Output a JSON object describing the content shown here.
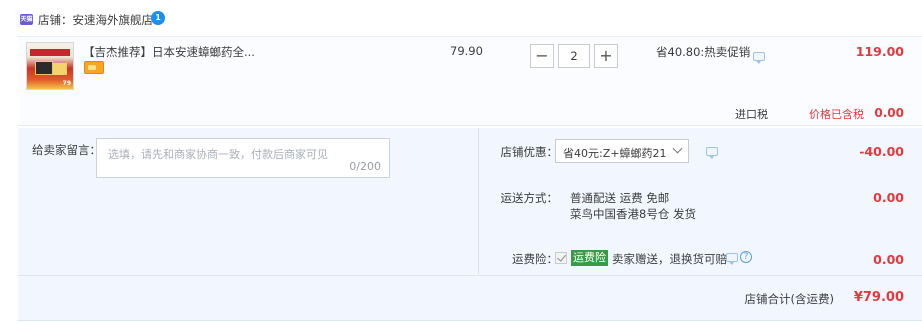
{
  "shop": {
    "icon_text": "天猫",
    "label": "店铺：安速海外旗舰店",
    "badge": "1"
  },
  "item": {
    "title": "【吉杰推荐】日本安速蟑螂药全...",
    "thumb_price": "79",
    "unit_price": "79.90",
    "qty_minus": "−",
    "qty_value": "2",
    "qty_plus": "+",
    "promo": "省40.80:热卖促销",
    "total": "119.00",
    "tax_label": "进口税",
    "tax_status": "价格已含税",
    "tax_value": "0.00"
  },
  "message": {
    "label": "给卖家留言：",
    "placeholder": "选填，请先和商家协商一致，付款后商家可见",
    "counter": "0/200"
  },
  "coupon": {
    "label": "店铺优惠：",
    "selected": "省40元:Z+蟑螂药21",
    "value": "-40.00"
  },
  "shipping": {
    "label": "运送方式：",
    "line1": "普通配送 运费 免邮",
    "warehouse": "菜鸟中国香港8号仓",
    "dispatch": "发货",
    "value": "0.00"
  },
  "insurance": {
    "label": "运费险：",
    "tag": "运费险",
    "desc": "卖家赠送，退换货可赔",
    "help": "?",
    "value": "0.00"
  },
  "summary": {
    "label": "店铺合计(含运费)",
    "total": "¥79.00"
  },
  "colors": {
    "accent_red": "#e4393c",
    "panel_bg": "#f2f7ff",
    "insurance_green": "#3a9b46"
  }
}
